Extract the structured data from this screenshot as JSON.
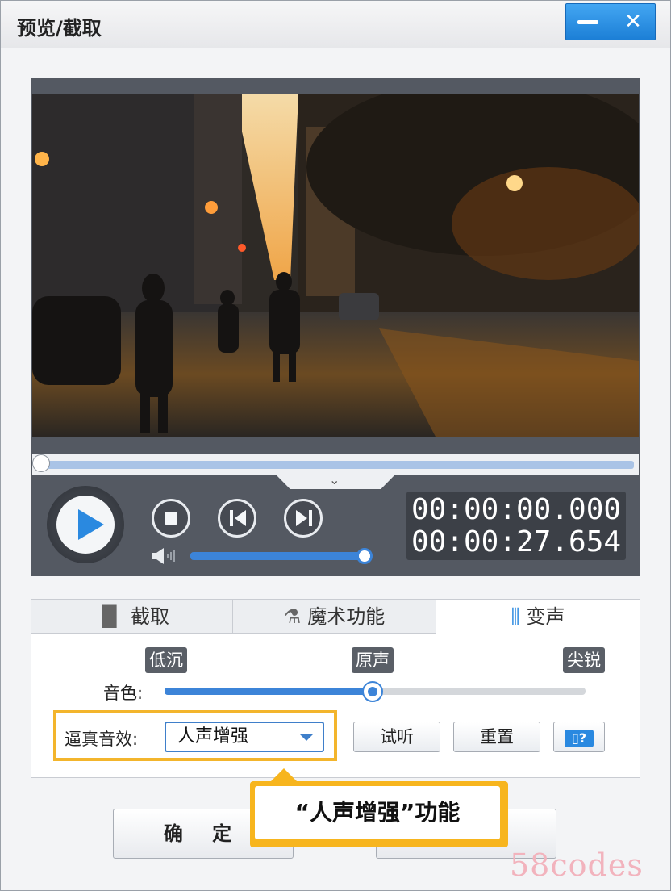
{
  "window": {
    "title": "预览/截取",
    "min_label": "—",
    "close_label": "✕"
  },
  "player": {
    "expand_label": "⌄",
    "time_current": "00:00:00.000",
    "time_total": "00:00:27.654",
    "progress": 0.0,
    "volume": 0.95
  },
  "tabs": [
    {
      "label": "截取",
      "icon": "clip-icon"
    },
    {
      "label": "魔术功能",
      "icon": "magic-icon"
    },
    {
      "label": "变声",
      "icon": "waveform-icon",
      "active": true
    }
  ],
  "voice": {
    "levels": [
      "低沉",
      "原声",
      "尖锐"
    ],
    "tone_label": "音色:",
    "tone_value": 0.5,
    "effect_label": "逼真音效:",
    "effect_value": "人声增强",
    "preview_label": "试听",
    "reset_label": "重置"
  },
  "footer": {
    "ok_label": "确 定"
  },
  "callout": "“人声增强”功能",
  "watermark": "58codes",
  "colors": {
    "accent": "#2a89e0",
    "highlight": "#f7b51e"
  }
}
